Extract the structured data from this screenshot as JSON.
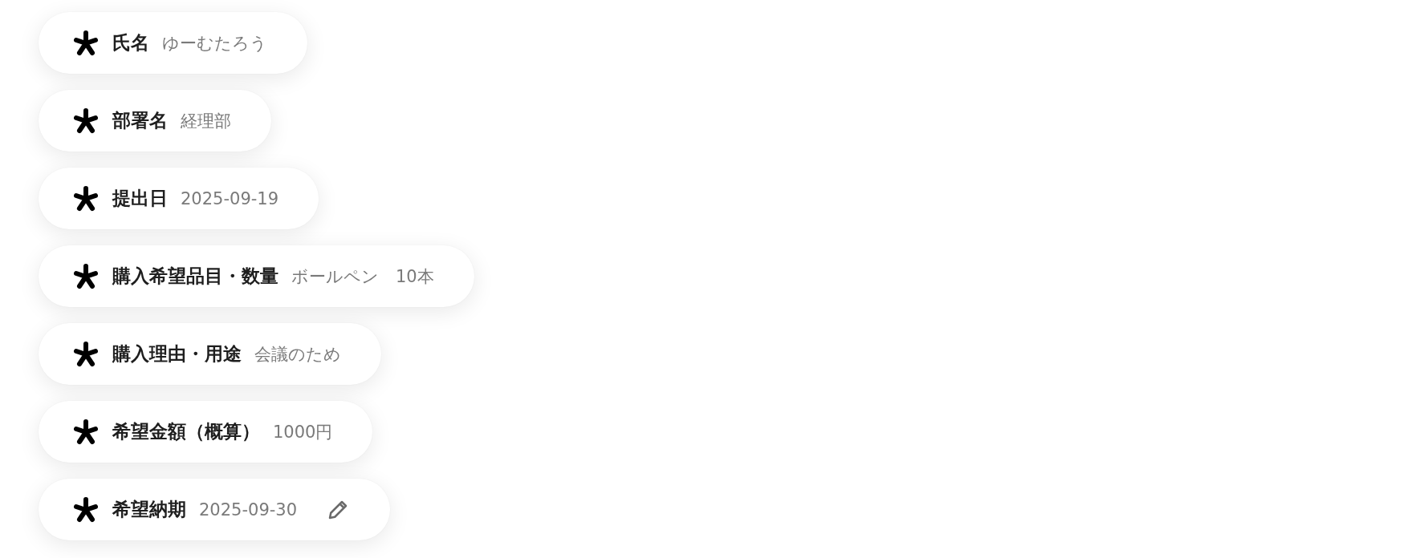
{
  "fields": [
    {
      "label": "氏名",
      "value": "ゆーむたろう",
      "editable": false
    },
    {
      "label": "部署名",
      "value": "経理部",
      "editable": false
    },
    {
      "label": "提出日",
      "value": "2025-09-19",
      "editable": false
    },
    {
      "label": "購入希望品目・数量",
      "value": "ボールペン　10本",
      "editable": false
    },
    {
      "label": "購入理由・用途",
      "value": "会議のため",
      "editable": false
    },
    {
      "label": "希望金額（概算）",
      "value": "1000円",
      "editable": false
    },
    {
      "label": "希望納期",
      "value": "2025-09-30",
      "editable": true
    }
  ]
}
